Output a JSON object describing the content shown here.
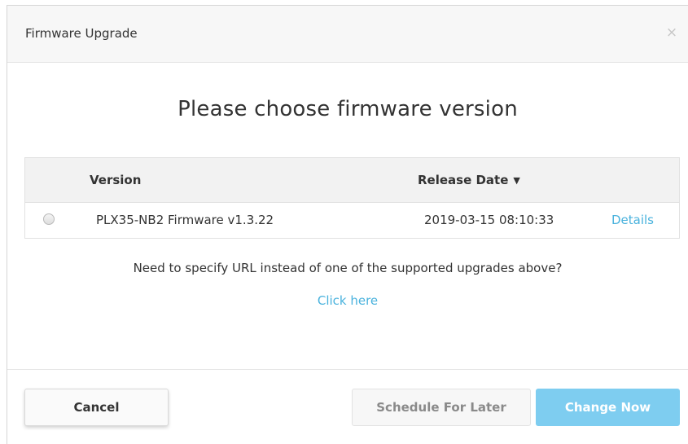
{
  "dialog": {
    "title": "Firmware Upgrade",
    "close_symbol": "×",
    "heading": "Please choose firmware version"
  },
  "table": {
    "columns": {
      "version": "Version",
      "release_date": "Release Date",
      "sort_symbol": "▼",
      "sort_icon": "sort-descending-icon"
    },
    "rows": [
      {
        "selected": false,
        "version": "PLX35-NB2 Firmware v1.3.22",
        "release_date": "2019-03-15 08:10:33",
        "details_link": "Details"
      }
    ]
  },
  "url_section": {
    "question": "Need to specify URL instead of one of the supported upgrades above?",
    "link": "Click here"
  },
  "buttons": {
    "cancel": "Cancel",
    "schedule": "Schedule For Later",
    "change_now": "Change Now"
  },
  "colors": {
    "link": "#49b2dd",
    "primary_button": "#7ecdf0",
    "header_bg": "#f7f7f7",
    "table_header_bg": "#f2f2f2"
  }
}
